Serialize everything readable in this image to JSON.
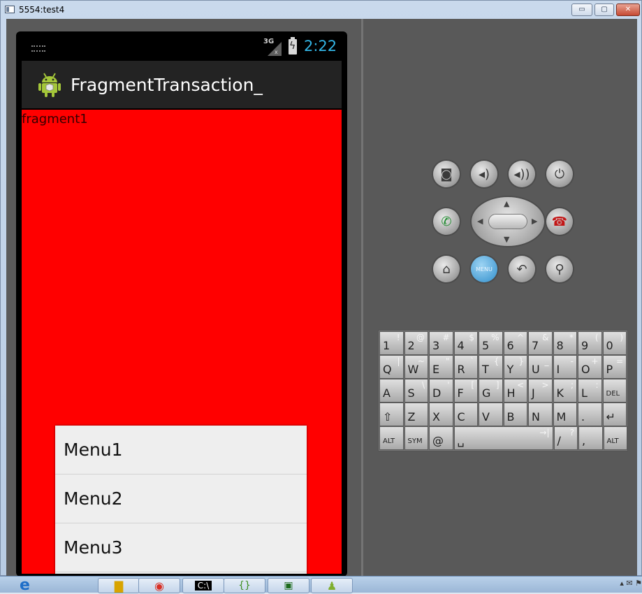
{
  "window": {
    "title": "5554:test4",
    "min_glyph": "▭",
    "max_glyph": "▢",
    "close_glyph": "✕"
  },
  "statusbar": {
    "network_label": "3G",
    "network_x": "x",
    "clock": "2:22"
  },
  "actionbar": {
    "title": "FragmentTransaction_"
  },
  "content": {
    "fragment_label": "fragment1",
    "background_color": "#ff0000"
  },
  "menu": {
    "items": [
      {
        "label": "Menu1"
      },
      {
        "label": "Menu2"
      },
      {
        "label": "Menu3"
      }
    ]
  },
  "hardware": {
    "camera_icon": "camera-icon",
    "volume_down_icon": "volume-down-icon",
    "volume_up_icon": "volume-up-icon",
    "power_icon": "power-icon",
    "call_icon": "call-icon",
    "end_call_icon": "end-call-icon",
    "home_icon": "home-icon",
    "menu_label": "MENU",
    "back_icon": "back-icon",
    "search_icon": "search-icon"
  },
  "keyboard": {
    "rows": [
      [
        {
          "main": "1",
          "alt": "!"
        },
        {
          "main": "2",
          "alt": "@"
        },
        {
          "main": "3",
          "alt": "#"
        },
        {
          "main": "4",
          "alt": "$"
        },
        {
          "main": "5",
          "alt": "%"
        },
        {
          "main": "6",
          "alt": "^"
        },
        {
          "main": "7",
          "alt": "&"
        },
        {
          "main": "8",
          "alt": "*"
        },
        {
          "main": "9",
          "alt": "("
        },
        {
          "main": "0",
          "alt": ")"
        }
      ],
      [
        {
          "main": "Q",
          "alt": "|"
        },
        {
          "main": "W",
          "alt": "~"
        },
        {
          "main": "E",
          "alt": "\""
        },
        {
          "main": "R",
          "alt": "`"
        },
        {
          "main": "T",
          "alt": "{"
        },
        {
          "main": "Y",
          "alt": "}"
        },
        {
          "main": "U",
          "alt": "_"
        },
        {
          "main": "I",
          "alt": "-"
        },
        {
          "main": "O",
          "alt": "+"
        },
        {
          "main": "P",
          "alt": "="
        }
      ],
      [
        {
          "main": "A",
          "alt": ""
        },
        {
          "main": "S",
          "alt": "\\"
        },
        {
          "main": "D",
          "alt": "'"
        },
        {
          "main": "F",
          "alt": "["
        },
        {
          "main": "G",
          "alt": "]"
        },
        {
          "main": "H",
          "alt": "<"
        },
        {
          "main": "J",
          "alt": ">"
        },
        {
          "main": "K",
          "alt": ";"
        },
        {
          "main": "L",
          "alt": ":"
        },
        {
          "main": "DEL",
          "alt": ""
        }
      ],
      [
        {
          "main": "⇧",
          "alt": ""
        },
        {
          "main": "Z",
          "alt": ""
        },
        {
          "main": "X",
          "alt": ""
        },
        {
          "main": "C",
          "alt": ""
        },
        {
          "main": "V",
          "alt": ""
        },
        {
          "main": "B",
          "alt": ""
        },
        {
          "main": "N",
          "alt": ""
        },
        {
          "main": "M",
          "alt": ""
        },
        {
          "main": ".",
          "alt": ""
        },
        {
          "main": "↵",
          "alt": ""
        }
      ],
      [
        {
          "main": "ALT",
          "alt": ""
        },
        {
          "main": "SYM",
          "alt": ""
        },
        {
          "main": "@",
          "alt": ""
        },
        {
          "main": "␣",
          "alt": "→|"
        },
        {
          "main": "/",
          "alt": "?"
        },
        {
          "main": ",",
          "alt": ""
        },
        {
          "main": "ALT",
          "alt": ""
        }
      ]
    ]
  },
  "taskbar": {
    "tray_text": "▴ ✉ ⚑"
  }
}
